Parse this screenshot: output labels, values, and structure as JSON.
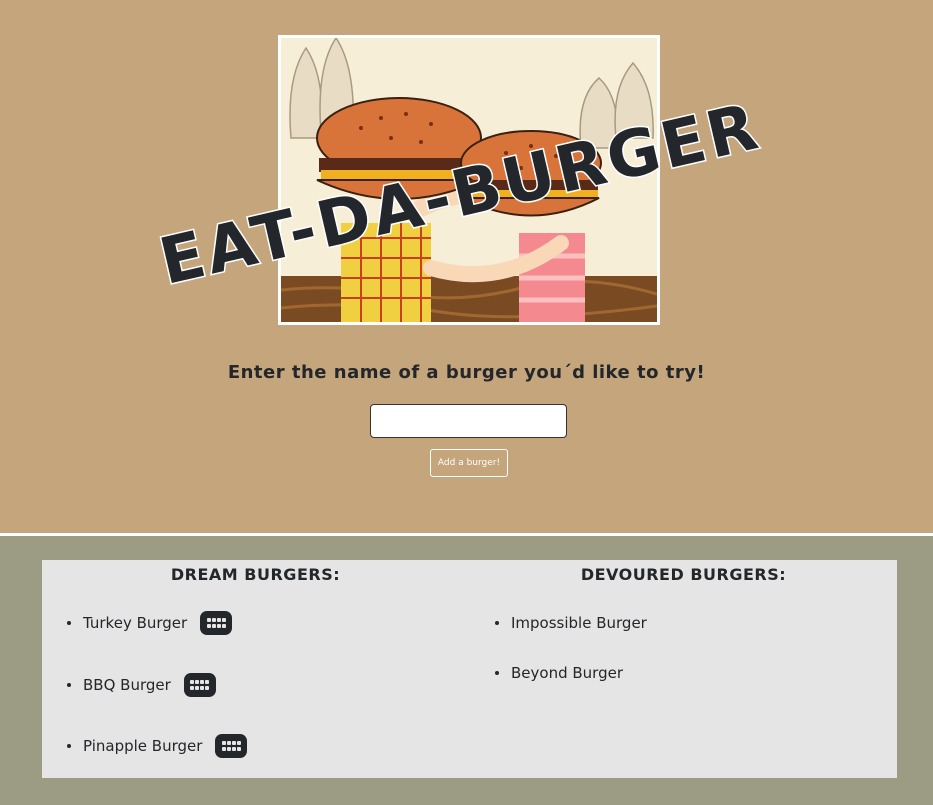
{
  "header": {
    "title": "EAT-DA-BURGER",
    "prompt": "Enter the name of a burger you´d like to try!"
  },
  "form": {
    "input_value": "",
    "input_placeholder": "",
    "submit_label": "Add a burger!"
  },
  "dream": {
    "heading": "DREAM BURGERS:",
    "items": [
      {
        "name": "Turkey Burger",
        "icon": "teeth-icon"
      },
      {
        "name": "BBQ Burger",
        "icon": "teeth-icon"
      },
      {
        "name": "Pinapple Burger",
        "icon": "teeth-icon"
      }
    ]
  },
  "devoured": {
    "heading": "DEVOURED BURGERS:",
    "items": [
      {
        "name": "Impossible Burger"
      },
      {
        "name": "Beyond Burger"
      }
    ]
  },
  "colors": {
    "top_bg": "#c4a57c",
    "bottom_bg": "#9c9c85",
    "panel_bg": "#e5e5e5",
    "text": "#23262b"
  }
}
